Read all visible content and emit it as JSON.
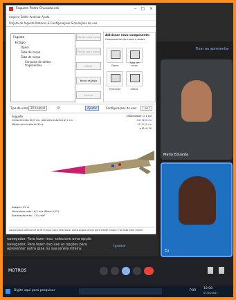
{
  "window": {
    "title": "Foguete Pedro Chuvado.ork",
    "menus": "Arquivo  Editar  Analisar  Ajuda",
    "tabs": "Projeto do foguete  Motores & Configurações  Simulações de voo"
  },
  "tree": {
    "root": "Foguete",
    "stage": "Estágio",
    "nose": "Ogiva",
    "tube1": "Tubo de corpo",
    "tube2": "Tubo de corpo",
    "fins": "Conjunto de aletas trapezoidais"
  },
  "mid_buttons": [
    "Mover para cima",
    "Mover para baixo",
    "Editar",
    "Novo estágio",
    "Excluir"
  ],
  "components": {
    "heading": "Adicionar novo componente:",
    "subheading": "Componentes do corpo e aletas",
    "items": [
      "Ogiva",
      "Tubo de corpo",
      "Transição",
      "Aletas"
    ]
  },
  "controls": {
    "view_label": "Tipo de vista:",
    "view_value": "2D Lateral",
    "angle": "0°",
    "zoom": "Ajustar",
    "config_label": "Configurações de voo:",
    "config_value": "[ no ]"
  },
  "plot": {
    "name": "Foguete",
    "length": "Comprimento 60,0 cm, diâmetro máximo 2,1 cm",
    "mass": "Massa sem motores 39 g",
    "stability": "Estabilidade: 2,1 cal",
    "cg": "CG 32,8 cm",
    "cp": "CP 37,2 cm",
    "mach": "a M=0,30",
    "apogee": "Apogeu: 22 m",
    "max_vel": "Velocidade máx.: 6,5 m/s (Mach 0,02)",
    "max_acc": "Aceleração máx.: 111 m/s²"
  },
  "statusbar": "Clique para selecionar   Shift+clique para selecionar outro   Duplo clique para editar   Clique e arraste para mover",
  "participants": {
    "p1": "Maria Eduarda",
    "p2": "Eu"
  },
  "meet": {
    "link": "Fixar ao apresentar",
    "chat1": "navegador. Para fazer isso, selecione uma opção",
    "chat2": "navegador. Para fazer isso use as opções para apresentar outra guia ou sua janela inteira.",
    "ignore": "Ignorar",
    "meeting_id": "MOTROS"
  },
  "taskbar": {
    "search": "Digite aqui para pesquisar",
    "lang": "POR",
    "time": "10:08",
    "date": "07/04/2021"
  },
  "colors": {
    "frame": "#ff8c1a",
    "rocket_body": "#a89770",
    "rocket_nose": "#cc1f6b",
    "tile_active": "#1d6fbf"
  }
}
